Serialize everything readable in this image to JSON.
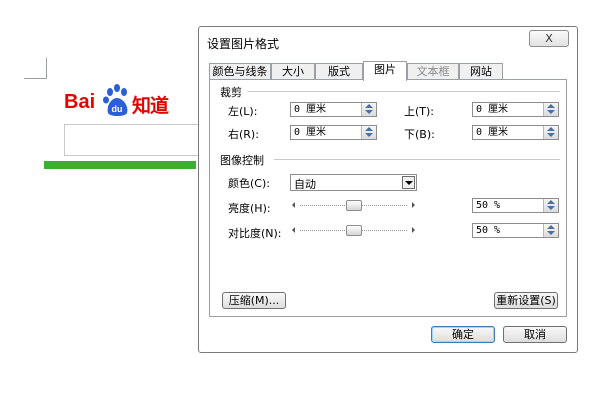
{
  "background": {
    "logo": {
      "latin": "Bai",
      "paw_text": "du",
      "chinese": "知道",
      "brand_color": "#e10601",
      "accent": "#2b5fd9"
    },
    "bar_color": "#3ab033"
  },
  "dialog": {
    "title": "设置图片格式",
    "close_label": "X",
    "tabs": [
      {
        "label": "颜色与线条",
        "state": "normal"
      },
      {
        "label": "大小",
        "state": "normal"
      },
      {
        "label": "版式",
        "state": "normal"
      },
      {
        "label": "图片",
        "state": "active"
      },
      {
        "label": "文本框",
        "state": "disabled"
      },
      {
        "label": "网站",
        "state": "normal"
      }
    ],
    "crop": {
      "heading": "裁剪",
      "left": {
        "label": "左(L):",
        "value": "0 厘米"
      },
      "right": {
        "label": "右(R):",
        "value": "0 厘米"
      },
      "top": {
        "label": "上(T):",
        "value": "0 厘米"
      },
      "bottom": {
        "label": "下(B):",
        "value": "0 厘米"
      }
    },
    "image_control": {
      "heading": "图像控制",
      "color": {
        "label": "颜色(C):",
        "value": "自动"
      },
      "brightness": {
        "label": "亮度(H):",
        "value": "50 %",
        "level": 0.5
      },
      "contrast": {
        "label": "对比度(N):",
        "value": "50 %",
        "level": 0.5
      }
    },
    "compress_label": "压缩(M)...",
    "reset_label": "重新设置(S)",
    "ok_label": "确定",
    "cancel_label": "取消"
  }
}
